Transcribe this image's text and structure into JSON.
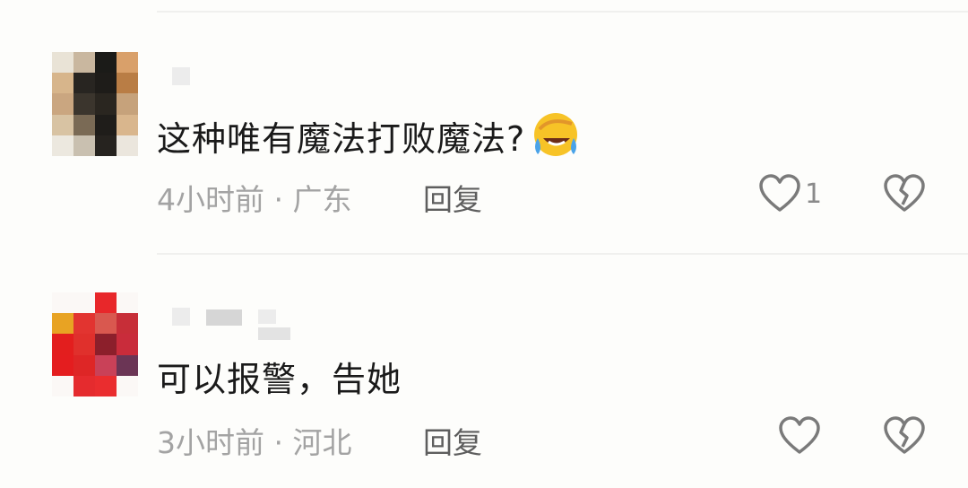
{
  "comments": [
    {
      "text": "这种唯有魔法打败魔法?",
      "emoji": "rolling-laughing-emoji",
      "time": "4小时前",
      "separator": "·",
      "location": "广东",
      "reply_label": "回复",
      "like_count": "1",
      "avatar_colors": [
        "#e9e3d6",
        "#c9b79f",
        "#1b1b18",
        "#d9a06a",
        "#d7b58b",
        "#282521",
        "#1e1c19",
        "#b97d45",
        "#caa680",
        "#3b352d",
        "#2a2620",
        "#c6a27b",
        "#d8c3a3",
        "#7a6a55",
        "#1f1d1a",
        "#d9b68d",
        "#ece8df",
        "#c9c0b0",
        "#26231f",
        "#ebe6dd"
      ]
    },
    {
      "text": "可以报警，告她",
      "time": "3小时前",
      "separator": "·",
      "location": "河北",
      "reply_label": "回复",
      "like_count": "",
      "avatar_colors": [
        "#fbf8f6",
        "#fbf8f6",
        "#e8272a",
        "#fbf8f6",
        "#e8a323",
        "#e23430",
        "#d9584f",
        "#c72e38",
        "#e31e1e",
        "#e0302c",
        "#8c1f2b",
        "#c92c3b",
        "#e41d1f",
        "#de2626",
        "#c94158",
        "#6b3555",
        "#fbf8f6",
        "#e52b2e",
        "#ea2d2f",
        "#fbf8f6"
      ]
    }
  ],
  "colors": {
    "text": "#1a1a1a",
    "meta": "#a3a3a3",
    "reply": "#5e5e5e",
    "icon": "#7a7a7a"
  }
}
